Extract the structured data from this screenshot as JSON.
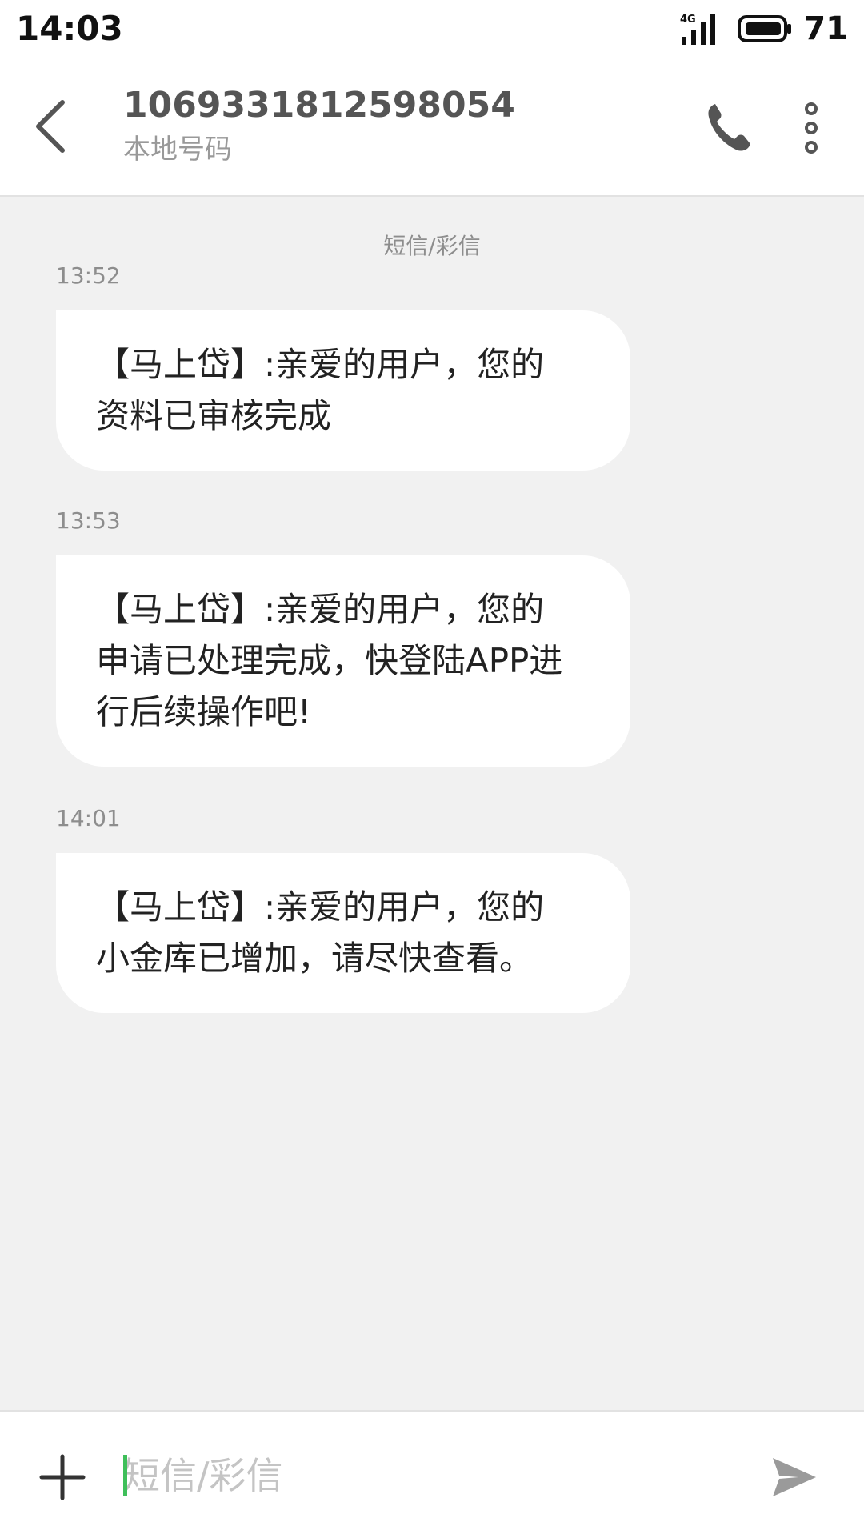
{
  "status_bar": {
    "time": "14:03",
    "network": "4G",
    "battery": "71"
  },
  "header": {
    "number": "1069331812598054",
    "subtitle": "本地号码",
    "icons": [
      "back-icon",
      "phone-icon",
      "more-vertical-icon"
    ]
  },
  "conversation": {
    "channel_label": "短信/彩信",
    "messages": [
      {
        "time": "13:52",
        "text": "【马上岱】:亲爱的用户，您的资料已审核完成"
      },
      {
        "time": "13:53",
        "text": "【马上岱】:亲爱的用户，您的申请已处理完成，快登陆APP进行后续操作吧!"
      },
      {
        "time": "14:01",
        "text": "【马上岱】:亲爱的用户，您的小金库已增加，请尽快查看。"
      }
    ]
  },
  "input_bar": {
    "placeholder": "短信/彩信",
    "value": "",
    "icons": [
      "plus-icon",
      "send-icon"
    ]
  },
  "colors": {
    "background": "#f1f1f1",
    "bubble": "#ffffff",
    "cursor": "#3fbf5a",
    "muted_text": "#8d8d8d"
  }
}
